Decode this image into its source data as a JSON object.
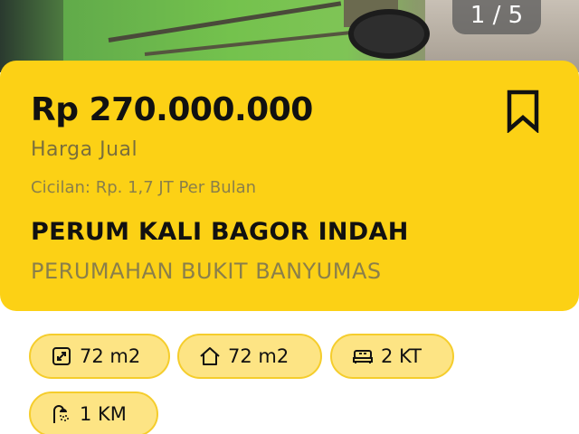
{
  "gallery": {
    "counter": "1 / 5"
  },
  "listing": {
    "price": "Rp 270.000.000",
    "price_label": "Harga Jual",
    "installment": "Cicilan: Rp. 1,7 JT Per Bulan",
    "property_name": "PERUM KALI BAGOR INDAH",
    "property_subtitle": "PERUMAHAN BUKIT BANYUMAS"
  },
  "features": [
    {
      "icon": "land-area-icon",
      "value": "72 m2"
    },
    {
      "icon": "house-icon",
      "value": "72 m2"
    },
    {
      "icon": "bed-icon",
      "value": "2 KT"
    },
    {
      "icon": "shower-icon",
      "value": "1 KM"
    }
  ],
  "colors": {
    "card": "#fcd115",
    "chip": "#fde484",
    "chip_border": "#f5cd2c",
    "text_primary": "#111111",
    "text_muted": "#8a7f4a"
  }
}
